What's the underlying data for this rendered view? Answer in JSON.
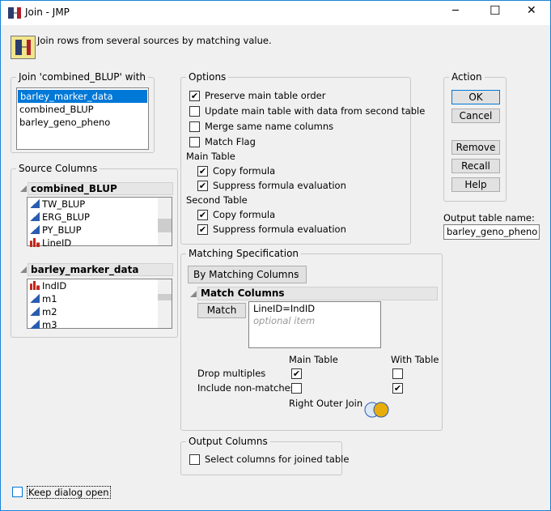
{
  "window": {
    "title": "Join - JMP",
    "minimize": "─",
    "maximize": "☐",
    "close": "✕"
  },
  "header": {
    "description": "Join rows from several sources by matching value."
  },
  "join_with": {
    "legend": "Join 'combined_BLUP' with",
    "items": [
      "barley_marker_data",
      "combined_BLUP",
      "barley_geno_pheno"
    ],
    "selected": 0
  },
  "source_columns": {
    "legend": "Source Columns",
    "tables": [
      {
        "name": "combined_BLUP",
        "columns": [
          {
            "name": "TW_BLUP",
            "type": "continuous"
          },
          {
            "name": "ERG_BLUP",
            "type": "continuous"
          },
          {
            "name": "PY_BLUP",
            "type": "continuous"
          },
          {
            "name": "LineID",
            "type": "nominal"
          }
        ]
      },
      {
        "name": "barley_marker_data",
        "columns": [
          {
            "name": "IndID",
            "type": "nominal"
          },
          {
            "name": "m1",
            "type": "continuous"
          },
          {
            "name": "m2",
            "type": "continuous"
          },
          {
            "name": "m3",
            "type": "continuous"
          }
        ]
      }
    ]
  },
  "options": {
    "legend": "Options",
    "items": [
      {
        "label": "Preserve main table order",
        "checked": true
      },
      {
        "label": "Update main table with data from second table",
        "checked": false
      },
      {
        "label": "Merge same name columns",
        "checked": false
      },
      {
        "label": "Match Flag",
        "checked": false
      }
    ],
    "main_table": {
      "label": "Main Table",
      "items": [
        {
          "label": "Copy formula",
          "checked": true
        },
        {
          "label": "Suppress formula evaluation",
          "checked": true
        }
      ]
    },
    "second_table": {
      "label": "Second Table",
      "items": [
        {
          "label": "Copy formula",
          "checked": true
        },
        {
          "label": "Suppress formula evaluation",
          "checked": true
        }
      ]
    }
  },
  "action": {
    "legend": "Action",
    "ok": "OK",
    "cancel": "Cancel",
    "remove": "Remove",
    "recall": "Recall",
    "help": "Help"
  },
  "output_name": {
    "label": "Output table name:",
    "value": "barley_geno_pheno"
  },
  "matching": {
    "legend": "Matching Specification",
    "method": "By Matching Columns",
    "match_columns_header": "Match Columns",
    "match_button": "Match",
    "pairs": [
      "LineID=IndID"
    ],
    "placeholder": "optional item",
    "main_table_label": "Main Table",
    "with_table_label": "With Table",
    "drop_multiples": {
      "label": "Drop multiples",
      "main": true,
      "with": false
    },
    "include_nonmatches": {
      "label": "Include non-matches",
      "main": false,
      "with": true
    },
    "join_type": "Right Outer Join"
  },
  "output_columns": {
    "legend": "Output Columns",
    "select_label": "Select columns for joined table",
    "checked": false
  },
  "keep_open": {
    "label": "Keep dialog open",
    "checked": false
  }
}
